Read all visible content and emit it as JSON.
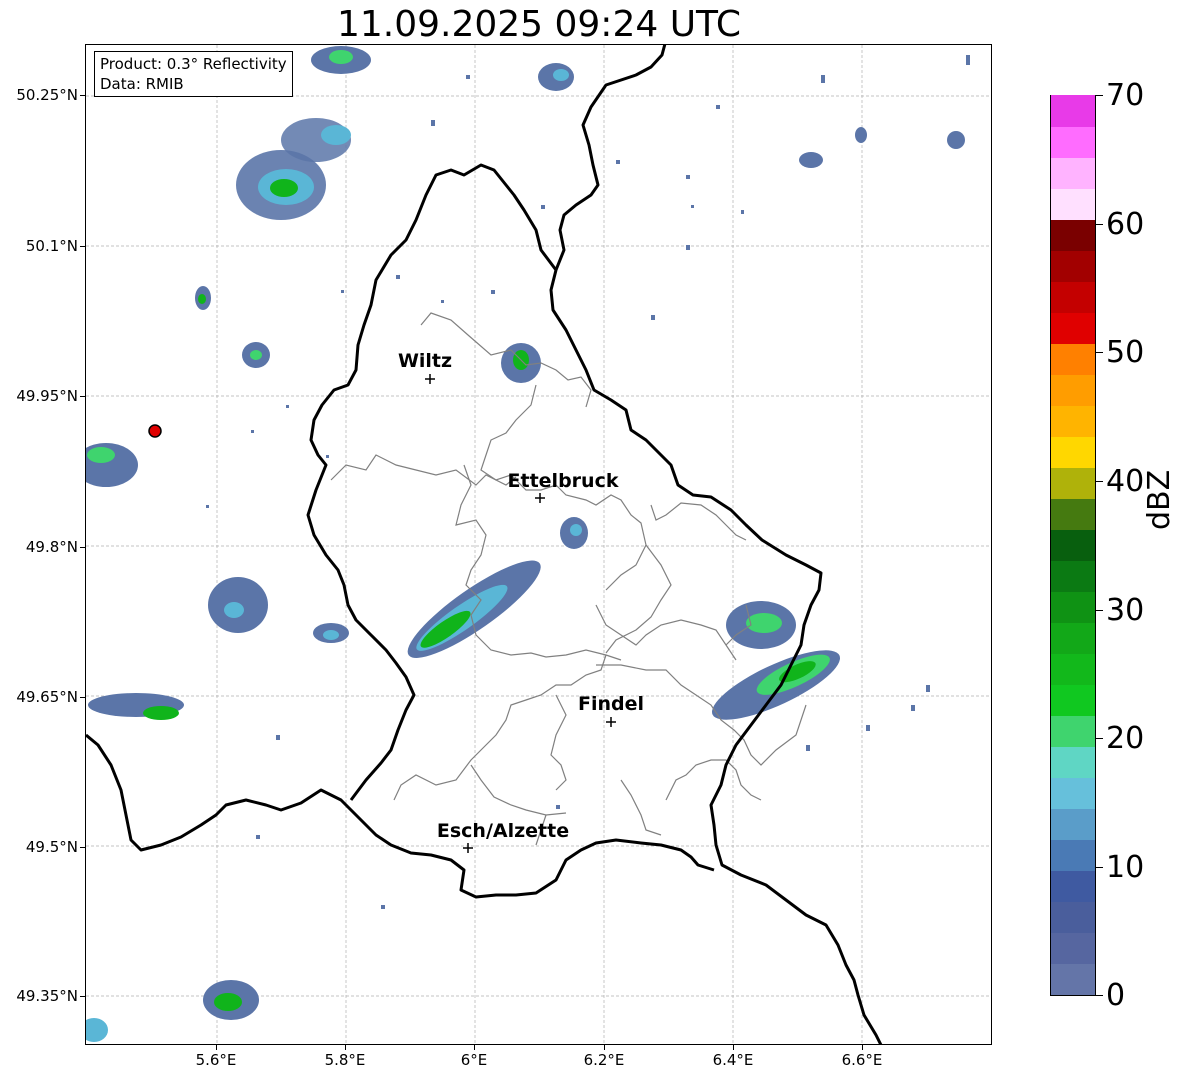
{
  "title": "11.09.2025 09:24 UTC",
  "info_box": {
    "product": "Product: 0.3° Reflectivity",
    "source": "Data: RMIB"
  },
  "axes": {
    "lat_ticks": [
      "50.25°N",
      "50.1°N",
      "49.95°N",
      "49.8°N",
      "49.65°N",
      "49.5°N",
      "49.35°N"
    ],
    "lon_ticks": [
      "5.6°E",
      "5.8°E",
      "6°E",
      "6.2°E",
      "6.4°E",
      "6.6°E"
    ],
    "lat_values": [
      50.25,
      50.1,
      49.95,
      49.8,
      49.65,
      49.5,
      49.35
    ],
    "lon_values": [
      5.6,
      5.8,
      6.0,
      6.2,
      6.4,
      6.6
    ],
    "grid": true
  },
  "cities": [
    {
      "name": "Wiltz",
      "lat": 49.966,
      "lon": 5.932
    },
    {
      "name": "Ettelbruck",
      "lat": 49.847,
      "lon": 6.104
    },
    {
      "name": "Findel",
      "lat": 49.627,
      "lon": 6.211
    },
    {
      "name": "Esch/Alzette",
      "lat": 49.5,
      "lon": 5.986
    }
  ],
  "radar_site": {
    "lat": 49.915,
    "lon": 5.505,
    "color": "#e00000"
  },
  "colorbar": {
    "label": "dBZ",
    "ticks": [
      "0",
      "10",
      "20",
      "30",
      "40",
      "50",
      "60",
      "70"
    ],
    "min": 0,
    "max": 70,
    "colors": [
      "#6475a8",
      "#5666a0",
      "#4a5e9c",
      "#3f5aa1",
      "#4a7ab5",
      "#5a9dc9",
      "#66c0db",
      "#5fd6c4",
      "#3fd46e",
      "#10c820",
      "#12b81b",
      "#12a818",
      "#0f9214",
      "#0b7a13",
      "#085f0e",
      "#457a10",
      "#afb20a",
      "#ffd700",
      "#ffb400",
      "#ff9d00",
      "#ff8000",
      "#e00000",
      "#c40000",
      "#a20000",
      "#7a0000",
      "#ffe0ff",
      "#ffb3ff",
      "#ff6cff",
      "#e83ae8"
    ]
  },
  "echo_colors": {
    "weak": "#5b75a8",
    "light": "#5ab6d6",
    "moderate": "#3fd46e",
    "strong": "#10b41b"
  }
}
